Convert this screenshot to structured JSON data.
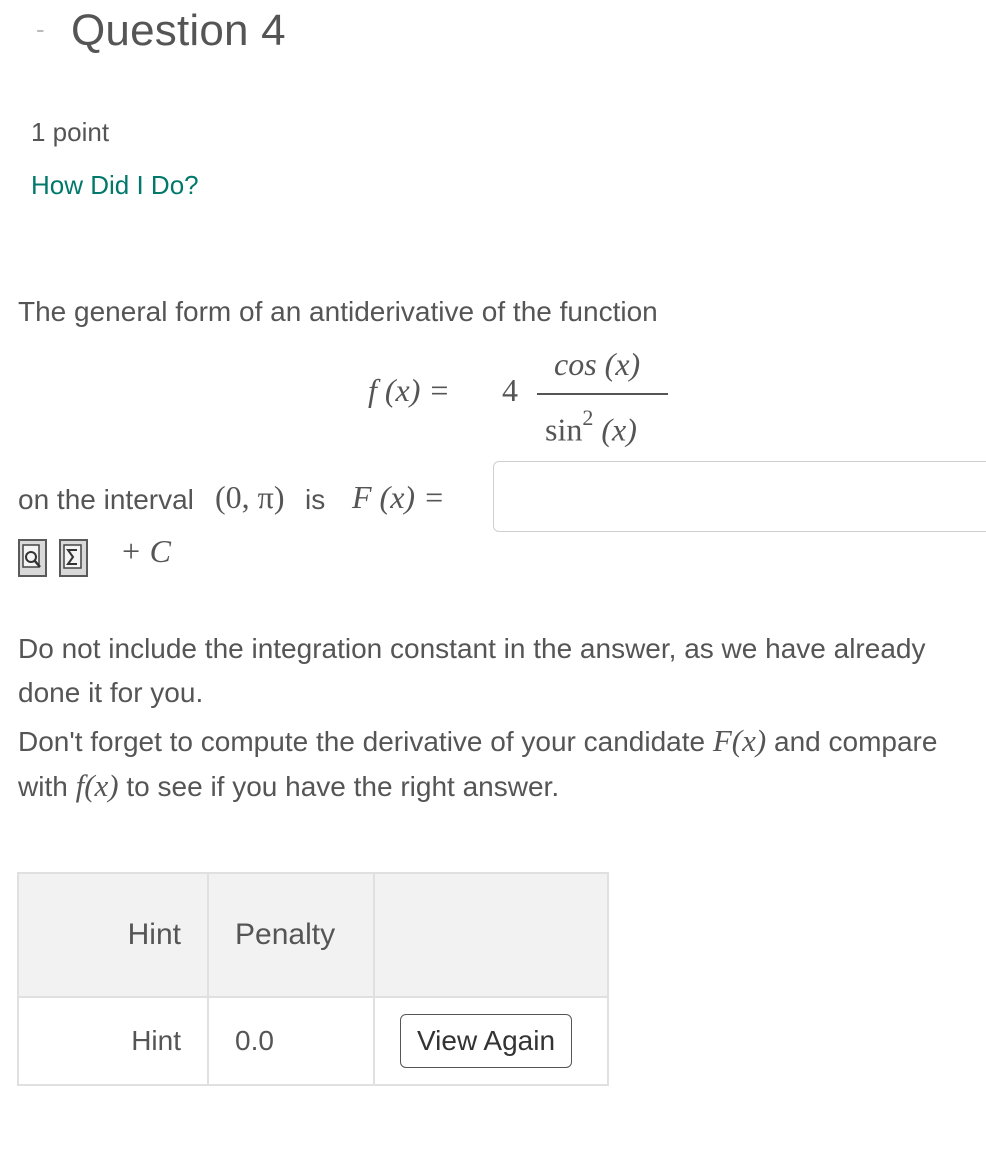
{
  "header": {
    "collapse_symbol": "-",
    "title": "Question 4",
    "points": "1 point",
    "feedback_link": "How Did I Do?"
  },
  "problem": {
    "prompt": "The general form of an antiderivative of the function",
    "fx_lhs": "f (x) =",
    "coefficient": "4",
    "numerator": "cos (x)",
    "denominator_base": "sin",
    "denominator_exp": "2",
    "denominator_arg": " (x)",
    "interval_text": "on the interval",
    "interval_math": "(0, π)",
    "is_word": "is",
    "Fx_lhs": "F (x) =",
    "answer_value": "",
    "constant": "+ C"
  },
  "notes": {
    "note1": "Do not include the integration constant in the answer, as we have already done it for you.",
    "note2_a": "Don't forget to compute the derivative of your candidate",
    "note2_F": "F(x)",
    "note2_b": "and compare with",
    "note2_f": "f(x)",
    "note2_c": "to see if you have the right answer."
  },
  "icons": {
    "preview": "preview-icon",
    "equation": "equation-editor-icon"
  },
  "hint_table": {
    "headers": [
      "Hint",
      "Penalty",
      ""
    ],
    "rows": [
      {
        "hint": "Hint",
        "penalty": "0.0",
        "action": "View Again"
      }
    ]
  },
  "colors": {
    "link": "#00796b",
    "text": "#555555",
    "table_header_bg": "#f2f2f2",
    "border": "#e0e0e0"
  }
}
